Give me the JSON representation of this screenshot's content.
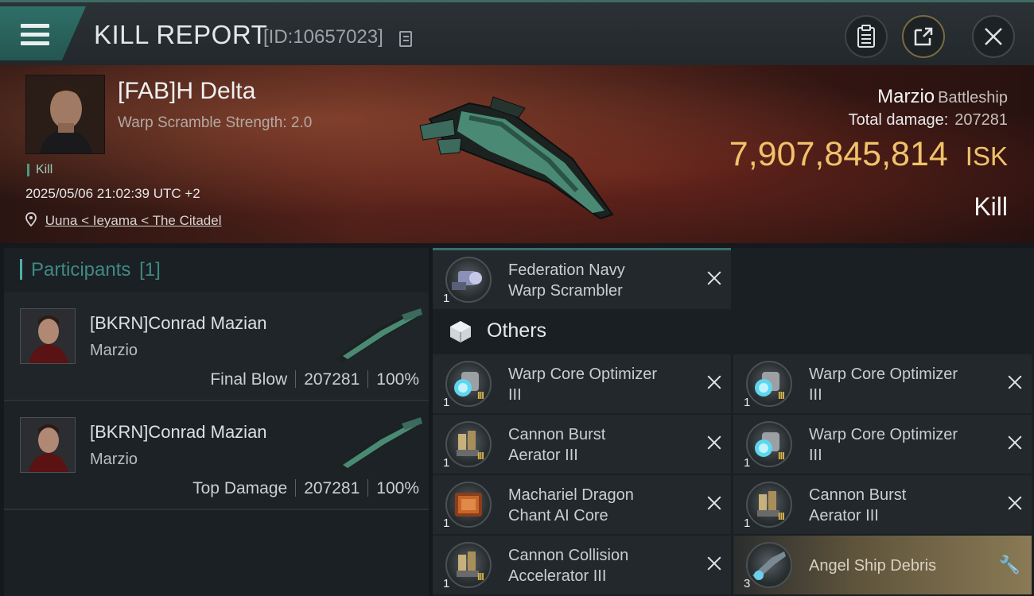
{
  "header": {
    "title": "KILL REPORT",
    "report_id": "[ID:10657023]",
    "icons": [
      "menu-icon",
      "copy-icon",
      "clipboard-icon",
      "share-icon",
      "close-icon"
    ]
  },
  "victim": {
    "name": "[FAB]H Delta",
    "scramble": "Warp Scramble Strength: 2.0",
    "tag": "Kill",
    "datetime": "2025/05/06 21:02:39 UTC +2",
    "location": "Uuna < Ieyama < The Citadel",
    "ship_name": "Marzio",
    "ship_class": "Battleship",
    "total_damage_label": "Total damage:",
    "total_damage": "207281",
    "isk_value": "7,907,845,814",
    "isk_unit": "ISK",
    "kill_type": "Kill"
  },
  "participants": {
    "label": "Participants",
    "count": "[1]",
    "rows": [
      {
        "name": "[BKRN]Conrad Mazian",
        "ship": "Marzio",
        "role": "Final Blow",
        "damage": "207281",
        "percent": "100%"
      },
      {
        "name": "[BKRN]Conrad Mazian",
        "ship": "Marzio",
        "role": "Top Damage",
        "damage": "207281",
        "percent": "100%"
      }
    ]
  },
  "items": {
    "top": {
      "name_l1": "Federation Navy",
      "name_l2": "Warp Scrambler",
      "qty": "1",
      "tier": ""
    },
    "others_label": "Others",
    "list": [
      {
        "name_l1": "Warp Core Optimizer",
        "name_l2": "III",
        "qty": "1",
        "tier": "III",
        "kind": "cyan"
      },
      {
        "name_l1": "Warp Core Optimizer",
        "name_l2": "III",
        "qty": "1",
        "tier": "III",
        "kind": "cyan"
      },
      {
        "name_l1": "Cannon Burst",
        "name_l2": "Aerator III",
        "qty": "1",
        "tier": "III",
        "kind": "gun"
      },
      {
        "name_l1": "Warp Core Optimizer",
        "name_l2": "III",
        "qty": "1",
        "tier": "III",
        "kind": "cyan"
      },
      {
        "name_l1": "Machariel Dragon",
        "name_l2": "Chant AI Core",
        "qty": "1",
        "tier": "",
        "kind": "core"
      },
      {
        "name_l1": "Cannon Burst",
        "name_l2": "Aerator III",
        "qty": "1",
        "tier": "III",
        "kind": "gun"
      },
      {
        "name_l1": "Cannon Collision",
        "name_l2": "Accelerator III",
        "qty": "1",
        "tier": "III",
        "kind": "gun"
      },
      {
        "name_l1": "Angel Ship Debris",
        "name_l2": "",
        "qty": "3",
        "tier": "",
        "kind": "debris"
      }
    ]
  },
  "colors": {
    "accent": "#3e8a84",
    "isk": "#f1c26a",
    "tier": "#d7b24a"
  }
}
